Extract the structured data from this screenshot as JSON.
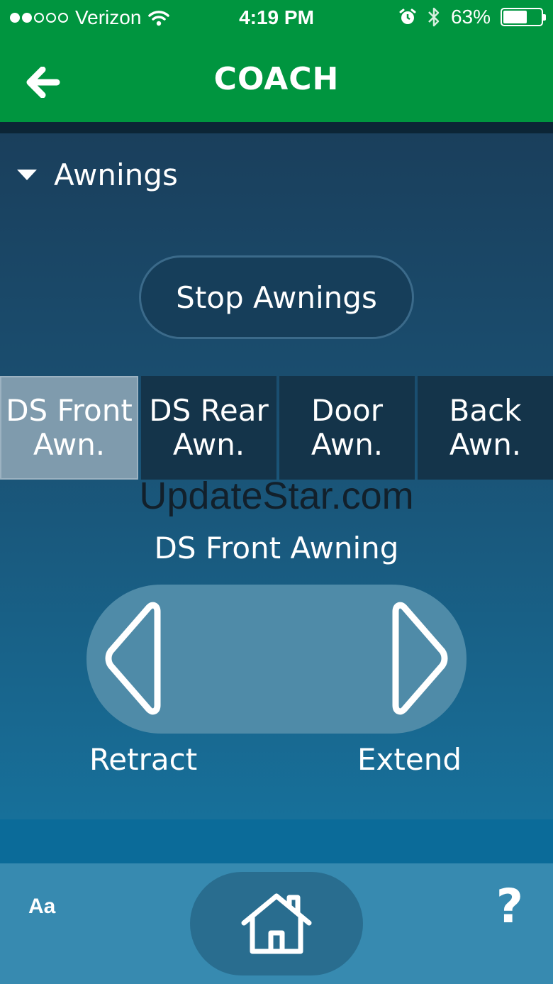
{
  "status_bar": {
    "carrier": "Verizon",
    "time": "4:19 PM",
    "battery": "63%",
    "battery_level": 0.63,
    "signal_bars_filled": 2,
    "signal_bars_total": 5
  },
  "nav": {
    "title": "COACH"
  },
  "section": {
    "label": "Awnings"
  },
  "stop_button": "Stop Awnings",
  "awnings": [
    {
      "line1": "DS Front",
      "line2": "Awn."
    },
    {
      "line1": "DS Rear",
      "line2": "Awn."
    },
    {
      "line1": "Door",
      "line2": "Awn."
    },
    {
      "line1": "Back",
      "line2": "Awn."
    }
  ],
  "selected_awning_index": 0,
  "watermark": "UpdateStar.com",
  "selected_awning_title": "DS Front Awning",
  "controls": {
    "retract_label": "Retract",
    "extend_label": "Extend"
  },
  "bottom_bar": {
    "font_label": "Aa",
    "help_label": "?"
  },
  "colors": {
    "header_green": "#00953f",
    "panel": "#1a4f71",
    "tab": "#14344a",
    "tab_active": "#7f9bad"
  }
}
